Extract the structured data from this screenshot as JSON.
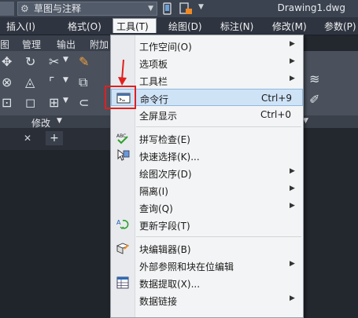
{
  "titlebar": {
    "workspace": "草图与注释",
    "document_title": "Drawing1.dwg"
  },
  "menubar": {
    "items": [
      "插入(I)",
      "格式(O)",
      "工具(T)",
      "绘图(D)",
      "标注(N)",
      "修改(M)",
      "参数(P)"
    ]
  },
  "ribbon_tabs": [
    "图",
    "管理",
    "输出",
    "附加"
  ],
  "ribbon": {
    "modify_label": "修改"
  },
  "tools_menu": {
    "items": [
      {
        "label": "工作空间(O)",
        "submenu": true
      },
      {
        "label": "选项板",
        "submenu": true
      },
      {
        "label": "工具栏",
        "submenu": true
      },
      {
        "label": "命令行",
        "shortcut": "Ctrl+9"
      },
      {
        "label": "全屏显示",
        "shortcut": "Ctrl+0"
      },
      {
        "label": "拼写检查(E)"
      },
      {
        "label": "快速选择(K)..."
      },
      {
        "label": "绘图次序(D)",
        "submenu": true
      },
      {
        "label": "隔离(I)",
        "submenu": true
      },
      {
        "label": "查询(Q)",
        "submenu": true
      },
      {
        "label": "更新字段(T)"
      },
      {
        "label": "块编辑器(B)"
      },
      {
        "label": "外部参照和块在位编辑",
        "submenu": true
      },
      {
        "label": "数据提取(X)..."
      },
      {
        "label": "数据链接",
        "submenu": true
      }
    ]
  },
  "colors": {
    "highlight_box": "#e02020",
    "menu_hover": "#cfe3f7"
  }
}
